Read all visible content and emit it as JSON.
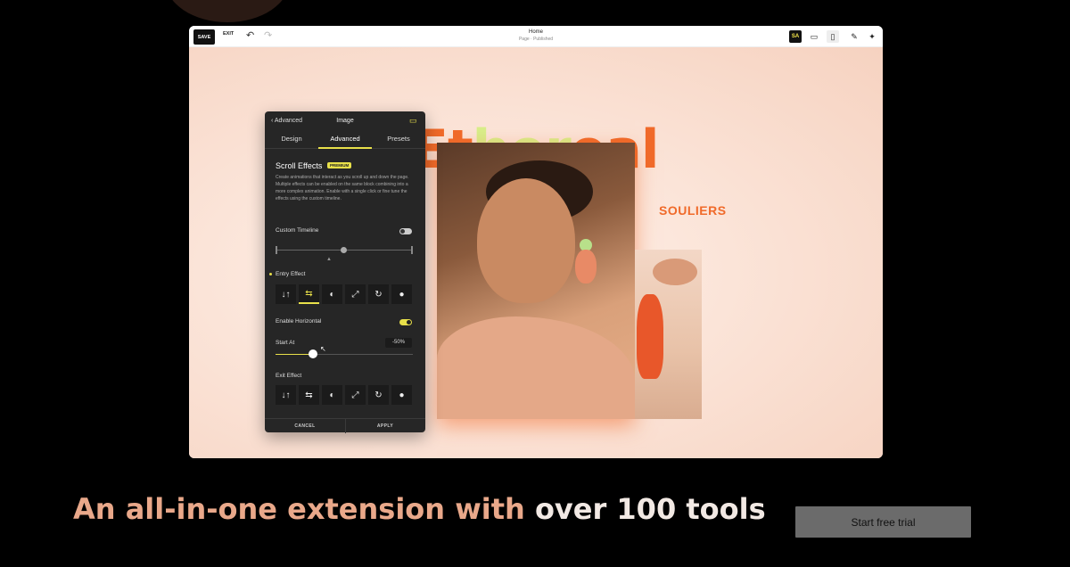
{
  "toolbar": {
    "save_label": "SAVE",
    "exit_label": "EXIT",
    "undo_icon": "undo-icon",
    "redo_icon": "redo-icon",
    "page_title": "Home",
    "page_status": "Page · Published",
    "extension_badge": "SA",
    "icons": [
      "extension-icon",
      "desktop-icon",
      "mobile-icon",
      "brush-icon",
      "magic-wand-icon"
    ]
  },
  "canvas": {
    "hero_word_before": "Et",
    "hero_word_highlight": "her",
    "hero_word_after": "eal",
    "subtitle": "SOULIERS",
    "accent": "#f06a2a",
    "highlight": "#d8ee8a"
  },
  "panel": {
    "back_label": "Advanced",
    "title": "Image",
    "tabs": [
      {
        "label": "Design",
        "active": false
      },
      {
        "label": "Advanced",
        "active": true
      },
      {
        "label": "Presets",
        "active": false
      }
    ],
    "section_title": "Scroll Effects",
    "premium_badge": "PREMIUM",
    "description": "Create animations that interact as you scroll up and down the page. Multiple effects can be enabled on the same block combining into a more complex animation. Enable with a single click or fine tune the effects using the custom timeline.",
    "custom_timeline_label": "Custom Timeline",
    "custom_timeline_on": false,
    "entry_effect_label": "Entry Effect",
    "entry_effects": [
      "↓↑",
      "⇆",
      "◐",
      "⤢",
      "↻",
      "●"
    ],
    "entry_effect_selected": 1,
    "enable_horizontal_label": "Enable Horizontal",
    "enable_horizontal_on": true,
    "start_at_label": "Start At",
    "start_at_value": "-50%",
    "start_at_slider_fraction": 0.27,
    "exit_effect_label": "Exit Effect",
    "exit_effects": [
      "↓↑",
      "⇆",
      "◐",
      "⤢",
      "↻",
      "●"
    ],
    "cancel_label": "CANCEL",
    "apply_label": "APPLY",
    "accent": "#e8e04a"
  },
  "marketing": {
    "tagline_part1": "An all-in-one extension with ",
    "tagline_part2": "over 100 tools",
    "cta_label": "Start free trial"
  }
}
